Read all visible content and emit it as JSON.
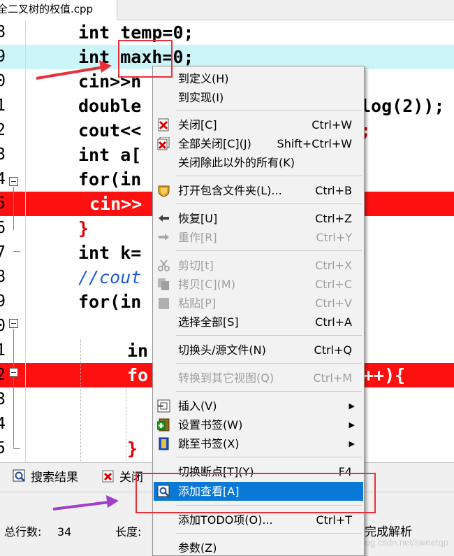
{
  "tab": {
    "title": "全二叉树的权值.cpp"
  },
  "editor": {
    "line_numbers": [
      "8",
      "9",
      "0",
      "1",
      "2",
      "3",
      "4",
      "5",
      "6",
      "7",
      "8",
      "9",
      "0",
      "1",
      "2",
      "3",
      "4",
      "5"
    ],
    "code": {
      "l1": "int temp=0;",
      "l2_a": "int ma",
      "l2_b": "xh=0;",
      "l3": "cin>>n",
      "l4_a": "double",
      "l4_b": "log(2));",
      "l5_a": "cout<<",
      "l5_b": ";",
      "l6": "int a[",
      "l7": "for(in",
      "l8": "cin>>",
      "l9": "}",
      "l10": "int k=",
      "l11": "//cout",
      "l12": "for(in",
      "l14": "in",
      "l15_a": "fo",
      "l15_b": "++){",
      "l18": "}"
    }
  },
  "menu": {
    "items": [
      {
        "label": "到定义(H)",
        "shortcut": ""
      },
      {
        "label": "到实现(I)",
        "shortcut": ""
      },
      {
        "label": "关闭[C]",
        "shortcut": "Ctrl+W"
      },
      {
        "label": "全部关闭[C](J)",
        "shortcut": "Shift+Ctrl+W"
      },
      {
        "label": "关闭除此以外的所有(K)",
        "shortcut": ""
      },
      {
        "label": "打开包含文件夹(L)...",
        "shortcut": "Ctrl+B"
      },
      {
        "label": "恢复[U]",
        "shortcut": "Ctrl+Z"
      },
      {
        "label": "重作[R]",
        "shortcut": "Ctrl+Y"
      },
      {
        "label": "剪切[t]",
        "shortcut": "Ctrl+X"
      },
      {
        "label": "拷贝[C](M)",
        "shortcut": "Ctrl+C"
      },
      {
        "label": "粘贴[P]",
        "shortcut": "Ctrl+V"
      },
      {
        "label": "选择全部[S]",
        "shortcut": "Ctrl+A"
      },
      {
        "label": "切换头/源文件(N)",
        "shortcut": "Ctrl+Q"
      },
      {
        "label": "转换到其它视图(Q)",
        "shortcut": "Ctrl+M"
      },
      {
        "label": "插入(V)",
        "shortcut": ""
      },
      {
        "label": "设置书签(W)",
        "shortcut": ""
      },
      {
        "label": "跳至书签(X)",
        "shortcut": ""
      },
      {
        "label": "切换断点[T](Y)",
        "shortcut": "F4"
      },
      {
        "label": "添加查看[A]",
        "shortcut": ""
      },
      {
        "label": "添加TODO项(O)...",
        "shortcut": "Ctrl+T"
      },
      {
        "label": "参数(Z)",
        "shortcut": ""
      }
    ]
  },
  "bottom_tabs": {
    "search_results": "搜索结果",
    "close": "关闭"
  },
  "status": {
    "total_lines_label": "总行数:",
    "total_lines_value": "34",
    "length_label": "长度:",
    "parse_done": "完成解析"
  },
  "watermark": "https://blog.csdn.net/sweetqp",
  "colors": {
    "breakpoint_line": "#ff1010",
    "current_line": "#ccf5fa",
    "menu_selected": "#0a78d7",
    "annotation_red": "#e8303a",
    "annotation_purple": "#a040c8"
  }
}
